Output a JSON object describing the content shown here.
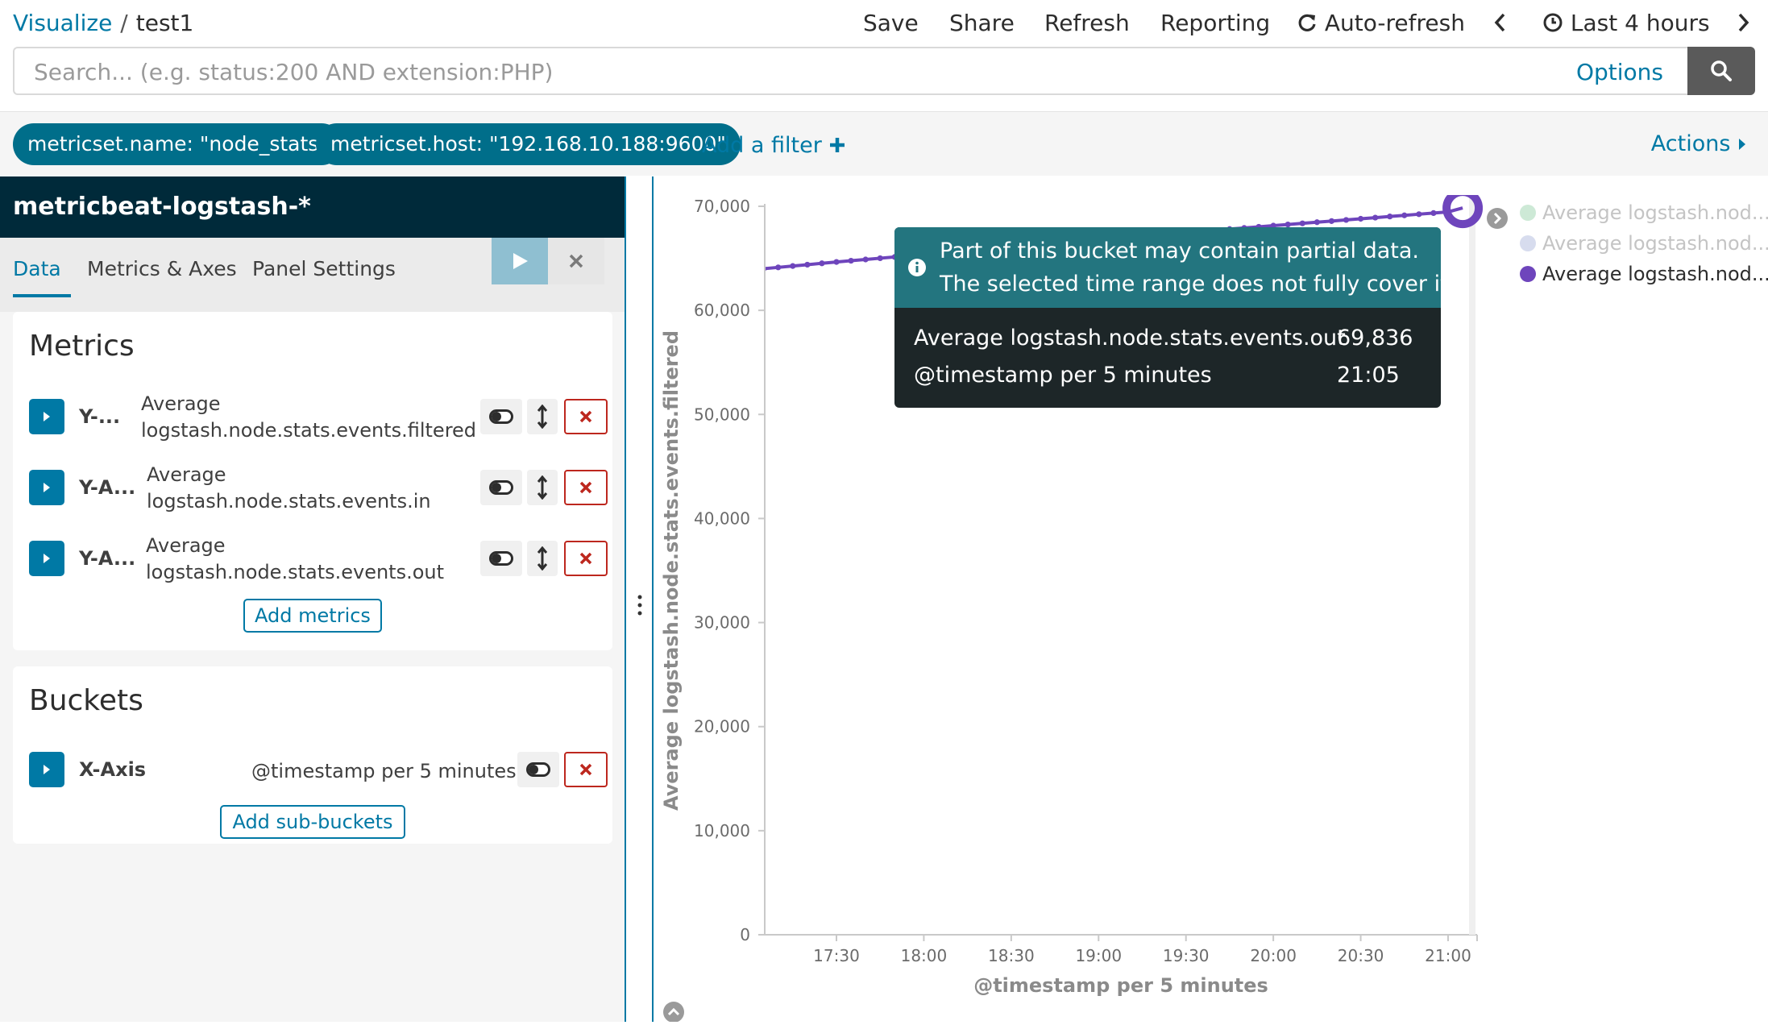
{
  "breadcrumb": {
    "root": "Visualize",
    "separator": "/",
    "current": "test1"
  },
  "topmenu": {
    "save": "Save",
    "share": "Share",
    "refresh": "Refresh",
    "reporting": "Reporting",
    "auto_refresh": "Auto-refresh",
    "time_range": "Last 4 hours"
  },
  "search": {
    "placeholder": "Search... (e.g. status:200 AND extension:PHP)",
    "options_label": "Options"
  },
  "filters": {
    "pills": [
      "metricset.name: \"node_stats\"",
      "metricset.host: \"192.168.10.188:9600\""
    ],
    "add_filter": "Add a filter",
    "actions": "Actions"
  },
  "sidebar": {
    "index_pattern": "metricbeat-logstash-*",
    "tabs": [
      "Data",
      "Metrics & Axes",
      "Panel Settings"
    ],
    "metrics_title": "Metrics",
    "metrics": [
      {
        "label": "Y-...",
        "desc1": "Average",
        "desc2": "logstash.node.stats.events.filtered"
      },
      {
        "label": "Y-A...",
        "desc1": "Average",
        "desc2": "logstash.node.stats.events.in"
      },
      {
        "label": "Y-A...",
        "desc1": "Average",
        "desc2": "logstash.node.stats.events.out"
      }
    ],
    "add_metrics": "Add metrics",
    "buckets_title": "Buckets",
    "bucket": {
      "label": "X-Axis",
      "desc": "@timestamp per 5 minutes"
    },
    "add_sub_buckets": "Add sub-buckets"
  },
  "tooltip": {
    "header_line1": "Part of this bucket may contain partial data.",
    "header_line2": "The selected time range does not fully cover it.",
    "rows": [
      {
        "label": "Average logstash.node.stats.events.out",
        "value": "69,836"
      },
      {
        "label": "@timestamp per 5 minutes",
        "value": "21:05"
      }
    ]
  },
  "legend": [
    {
      "label": "Average logstash.nod...",
      "color": "#cde9d6"
    },
    {
      "label": "Average logstash.nod...",
      "color": "#d7dcee"
    },
    {
      "label": "Average logstash.nod...",
      "color": "#6e45bc"
    }
  ],
  "colors": {
    "accent": "#0079a5",
    "line": "#6e45bc",
    "danger": "#bd271e"
  },
  "chart_data": {
    "type": "line",
    "ylabel": "Average logstash.node.stats.events.filtered",
    "xlabel": "@timestamp per 5 minutes",
    "ylim": [
      0,
      70000
    ],
    "y_ticks": [
      "0",
      "10,000",
      "20,000",
      "30,000",
      "40,000",
      "50,000",
      "60,000",
      "70,000"
    ],
    "x_ticks": [
      "17:30",
      "18:00",
      "18:30",
      "19:00",
      "19:30",
      "20:00",
      "20:30",
      "21:00"
    ],
    "grid": false,
    "series": [
      {
        "name": "Average logstash.node.stats.events.out",
        "x": [
          "17:05",
          "17:10",
          "17:15",
          "17:20",
          "17:25",
          "17:30",
          "17:35",
          "17:40",
          "17:45",
          "17:50",
          "17:55",
          "18:00",
          "18:05",
          "18:10",
          "18:15",
          "18:20",
          "18:25",
          "18:30",
          "18:35",
          "18:40",
          "18:45",
          "18:50",
          "18:55",
          "19:00",
          "19:05",
          "19:10",
          "19:15",
          "19:20",
          "19:25",
          "19:30",
          "19:35",
          "19:40",
          "19:45",
          "19:50",
          "19:55",
          "20:00",
          "20:05",
          "20:10",
          "20:15",
          "20:20",
          "20:25",
          "20:30",
          "20:35",
          "20:40",
          "20:45",
          "20:50",
          "20:55",
          "21:00",
          "21:05"
        ],
        "values": [
          64000,
          64130,
          64260,
          64390,
          64520,
          64650,
          64770,
          64890,
          65010,
          65130,
          65250,
          65370,
          65490,
          65610,
          65730,
          65850,
          65970,
          66090,
          66210,
          66330,
          66450,
          66570,
          66690,
          66810,
          66930,
          67040,
          67150,
          67260,
          67370,
          67480,
          67590,
          67700,
          67810,
          67920,
          68030,
          68140,
          68250,
          68360,
          68470,
          68580,
          68690,
          68800,
          68910,
          69020,
          69130,
          69240,
          69350,
          69460,
          69836
        ]
      }
    ]
  }
}
